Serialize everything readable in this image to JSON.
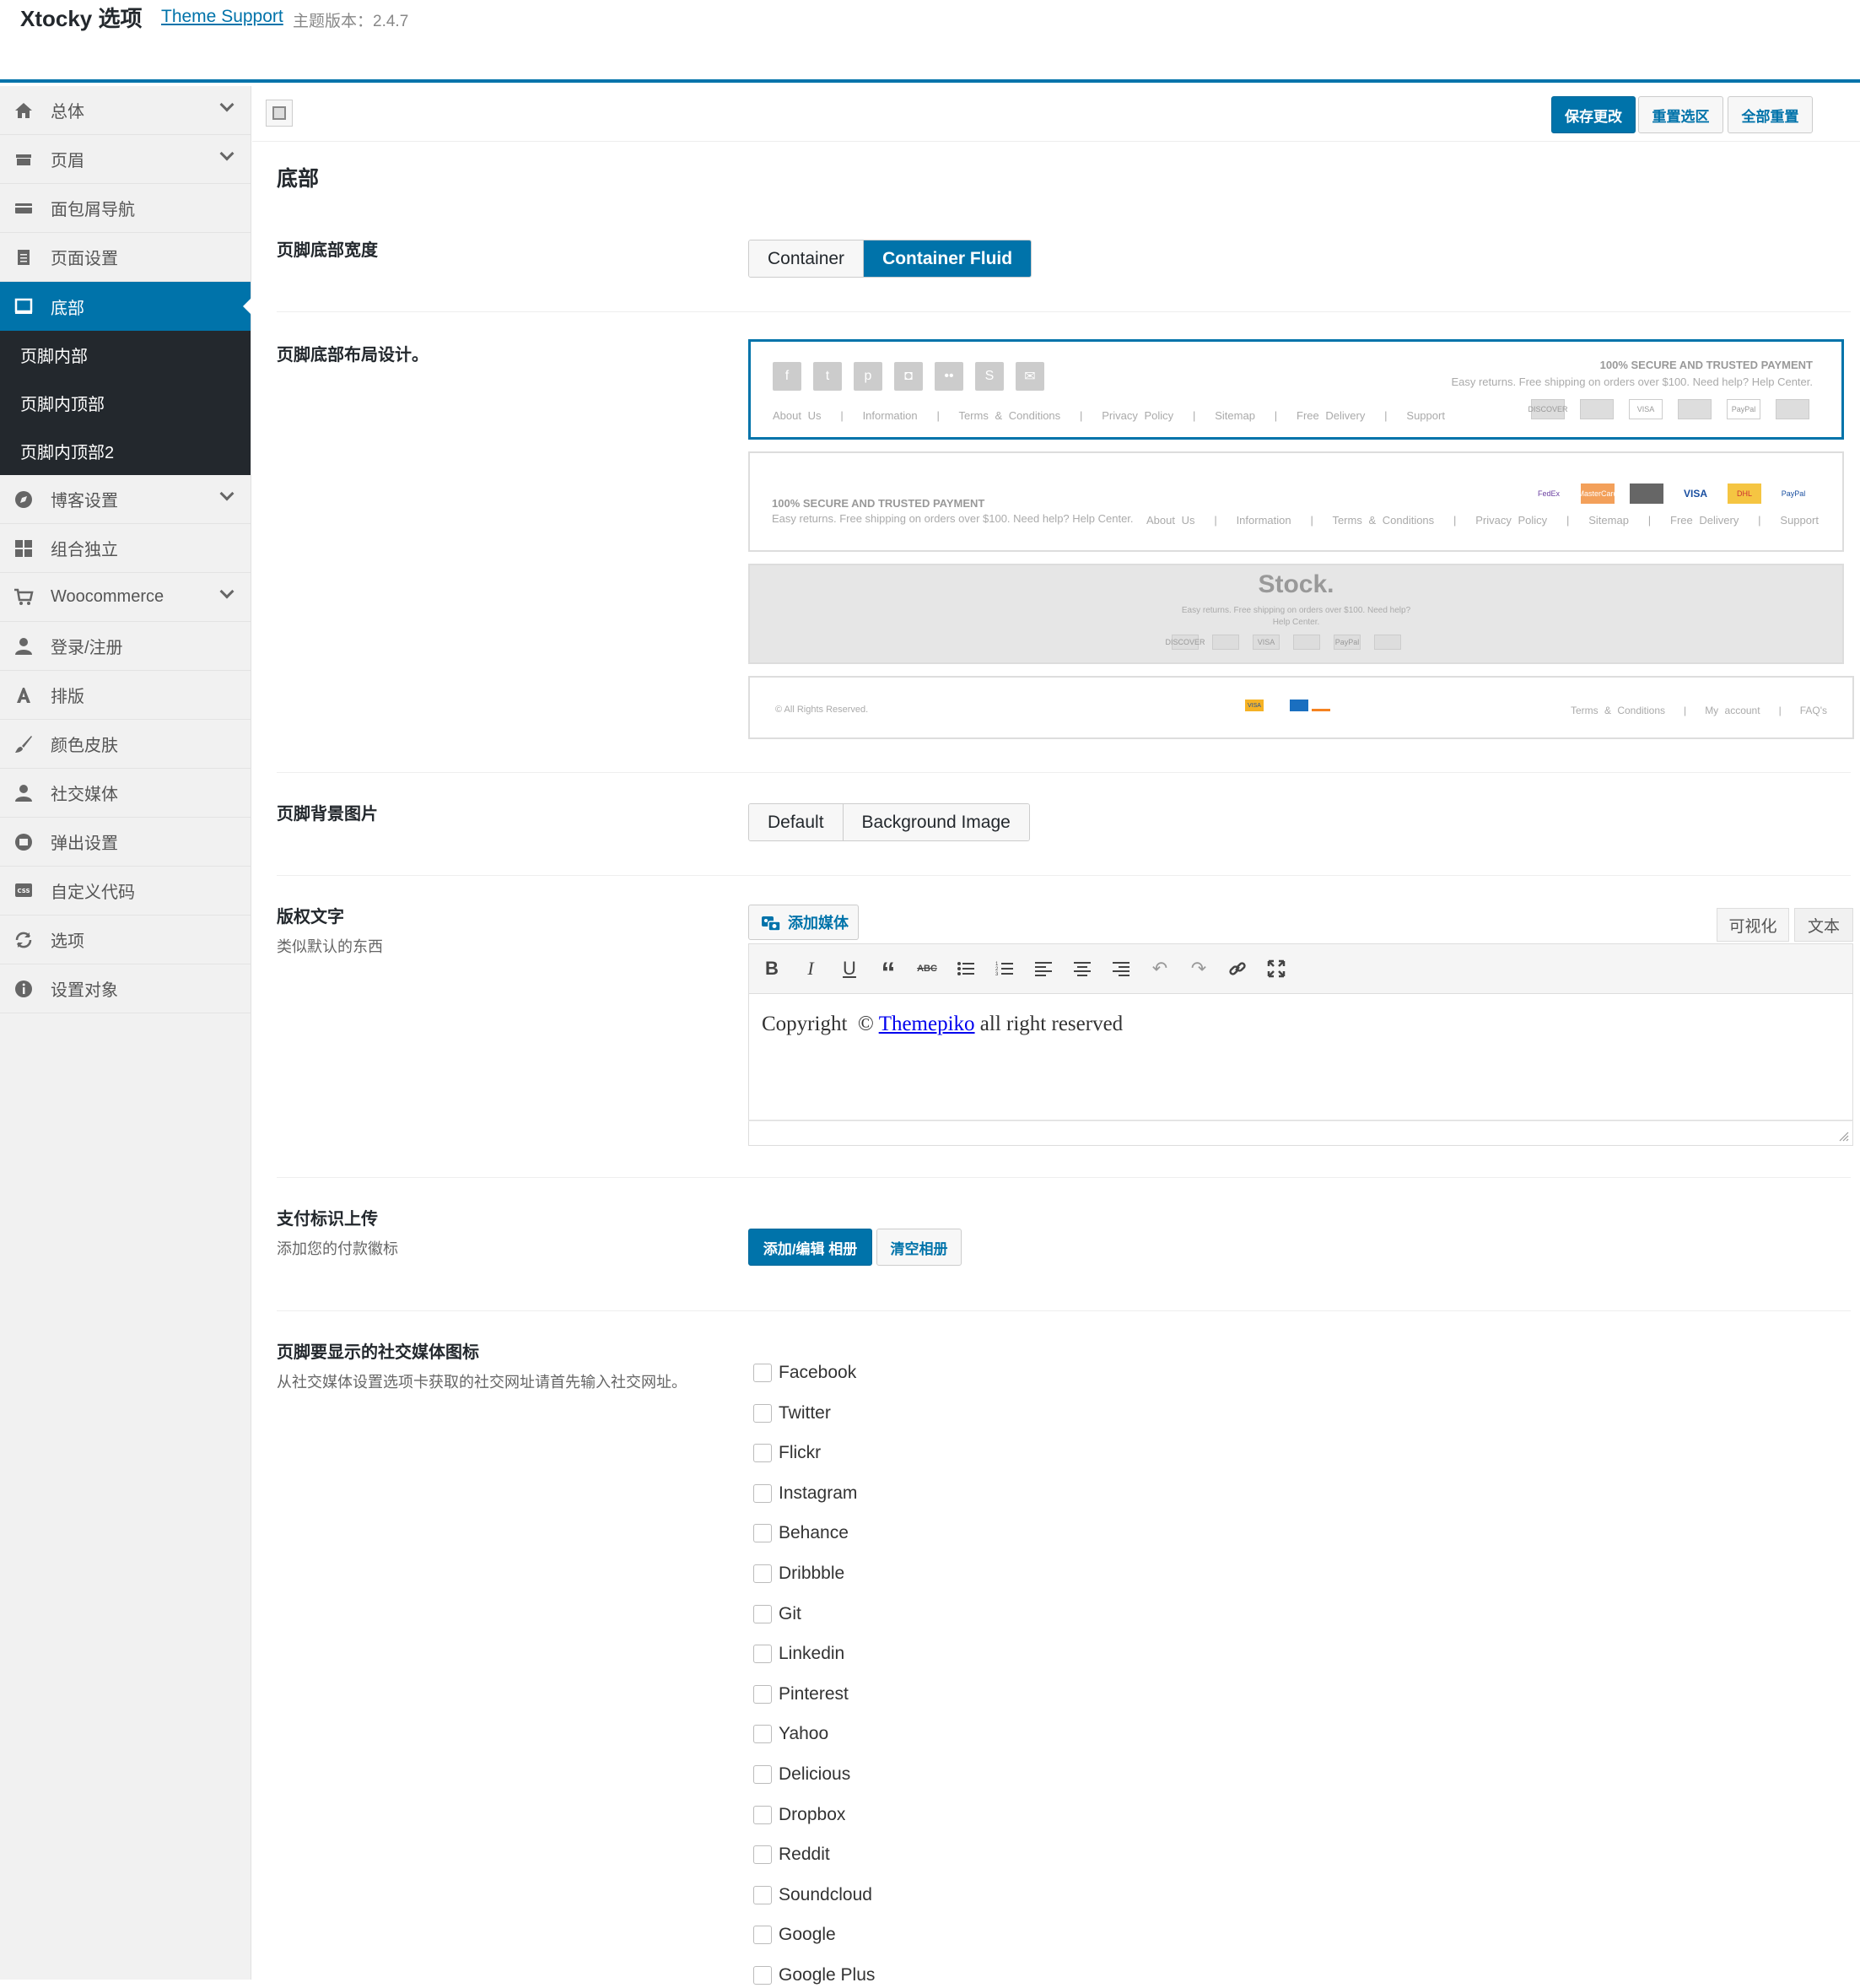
{
  "header": {
    "app_title": "Xtocky 选项",
    "theme_support": "Theme Support",
    "version": "主题版本：2.4.7"
  },
  "sidebar": {
    "items": [
      {
        "label": "总体",
        "icon": "home-icon"
      },
      {
        "label": "页眉",
        "icon": "header-icon"
      },
      {
        "label": "面包屑导航",
        "icon": "breadcrumb-icon"
      },
      {
        "label": "页面设置",
        "icon": "page-icon"
      },
      {
        "label": "底部",
        "icon": "footer-icon"
      }
    ],
    "sub_items": [
      "页脚内部",
      "页脚内顶部",
      "页脚内顶部2"
    ],
    "items2": [
      {
        "label": "博客设置",
        "icon": "compass-icon"
      },
      {
        "label": "组合独立",
        "icon": "grid-icon"
      },
      {
        "label": "Woocommerce",
        "icon": "cart-icon"
      },
      {
        "label": "登录/注册",
        "icon": "user-icon"
      },
      {
        "label": "排版",
        "icon": "font-icon"
      },
      {
        "label": "颜色皮肤",
        "icon": "brush-icon"
      },
      {
        "label": "社交媒体",
        "icon": "user-icon"
      },
      {
        "label": "弹出设置",
        "icon": "popup-icon"
      },
      {
        "label": "自定义代码",
        "icon": "css-icon"
      },
      {
        "label": "选项",
        "icon": "refresh-icon"
      },
      {
        "label": "设置对象",
        "icon": "info-icon"
      }
    ]
  },
  "toolbar": {
    "save": "保存更改",
    "reset_section": "重置选区",
    "reset_all": "全部重置"
  },
  "section_title": "底部",
  "footer_width": {
    "label": "页脚底部宽度",
    "options": [
      "Container",
      "Container Fluid"
    ],
    "selected": "Container Fluid"
  },
  "footer_layout": {
    "label": "页脚底部布局设计。",
    "l1": {
      "payment_title": "100% SECURE AND TRUSTED PAYMENT",
      "payment_text": "Easy returns. Free shipping on orders over $100. Need help? Help Center.",
      "links": [
        "About Us",
        "|",
        "Information",
        "|",
        "Terms & Conditions",
        "|",
        "Privacy Policy",
        "|",
        "Sitemap",
        "|",
        "Free Delivery",
        "|",
        "Support"
      ],
      "cards": [
        "DISCOVER",
        "",
        "VISA",
        "",
        "PayPal",
        ""
      ]
    },
    "l2": {
      "payment_title": "100% SECURE AND TRUSTED PAYMENT",
      "payment_text": "Easy returns. Free shipping on orders over $100. Need help? Help Center.",
      "links": [
        "About Us",
        "|",
        "Information",
        "|",
        "Terms & Conditions",
        "|",
        "Privacy Policy",
        "|",
        "Sitemap",
        "|",
        "Free Delivery",
        "|",
        "Support"
      ],
      "cards": [
        "FedEx",
        "MasterCard",
        "",
        "VISA",
        "DHL",
        "PayPal"
      ]
    },
    "l3": {
      "brand": "Stock.",
      "text1": "Easy returns. Free shipping on orders over $100. Need help?",
      "text2": "Help Center.",
      "cards": [
        "DISCOVER",
        "",
        "VISA",
        "",
        "PayPal",
        ""
      ]
    },
    "l4": {
      "copyright": "© All Rights Reserved.",
      "links": [
        "Terms & Conditions",
        "|",
        "My account",
        "|",
        "FAQ's"
      ],
      "cards": [
        "VISA",
        "",
        "",
        "",
        ""
      ]
    }
  },
  "footer_bg": {
    "label": "页脚背景图片",
    "options": [
      "Default",
      "Background Image"
    ]
  },
  "copyright": {
    "label": "版权文字",
    "desc": "类似默认的东西",
    "add_media": "添加媒体",
    "tab_visual": "可视化",
    "tab_text": "文本",
    "content_pre": "Copyright  © ",
    "content_link": "Themepiko",
    "content_post": " all right reserved"
  },
  "payment": {
    "label": "支付标识上传",
    "desc": "添加您的付款徽标",
    "add_edit": "添加/编辑 相册",
    "clear": "清空相册"
  },
  "social": {
    "label": "页脚要显示的社交媒体图标",
    "desc": "从社交媒体设置选项卡获取的社交网址请首先输入社交网址。",
    "items": [
      "Facebook",
      "Twitter",
      "Flickr",
      "Instagram",
      "Behance",
      "Dribbble",
      "Git",
      "Linkedin",
      "Pinterest",
      "Yahoo",
      "Delicious",
      "Dropbox",
      "Reddit",
      "Soundcloud",
      "Google",
      "Google Plus"
    ]
  }
}
